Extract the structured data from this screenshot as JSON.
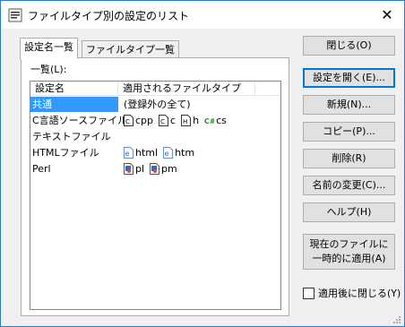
{
  "window": {
    "title": "ファイルタイプ別の設定のリスト"
  },
  "tabs": [
    {
      "label": "設定名一覧",
      "active": true
    },
    {
      "label": "ファイルタイプ一覧",
      "active": false
    }
  ],
  "list": {
    "label": "一覧(L):",
    "columns": [
      "設定名",
      "適用されるファイルタイプ"
    ],
    "rows": [
      {
        "name": "共通",
        "types_text": "(登録外の全て)",
        "selected": true
      },
      {
        "name": "C言語ソースファイル",
        "types": [
          {
            "icon": "cpp-file-icon",
            "ext": "cpp"
          },
          {
            "icon": "c-file-icon",
            "ext": "c"
          },
          {
            "icon": "h-file-icon",
            "ext": "h"
          },
          {
            "icon": "csharp-file-icon",
            "ext": "cs"
          }
        ]
      },
      {
        "name": "テキストファイル",
        "types": []
      },
      {
        "name": "HTMLファイル",
        "types": [
          {
            "icon": "html-file-icon",
            "ext": "html"
          },
          {
            "icon": "htm-file-icon",
            "ext": "htm"
          }
        ]
      },
      {
        "name": "Perl",
        "types": [
          {
            "icon": "perl-file-icon",
            "ext": "pl"
          },
          {
            "icon": "perl-module-icon",
            "ext": "pm"
          }
        ]
      }
    ]
  },
  "buttons": {
    "close": "閉じる(O)",
    "open_settings": "設定を開く(E)...",
    "new": "新規(N)...",
    "copy": "コピー(P)...",
    "delete": "削除(R)",
    "rename": "名前の変更(C)...",
    "help": "ヘルプ(H)",
    "apply_line1": "現在のファイルに",
    "apply_line2": "一時的に適用(A)"
  },
  "options": {
    "close_after_apply": "適用後に閉じる(Y)",
    "close_after_apply_checked": false
  }
}
